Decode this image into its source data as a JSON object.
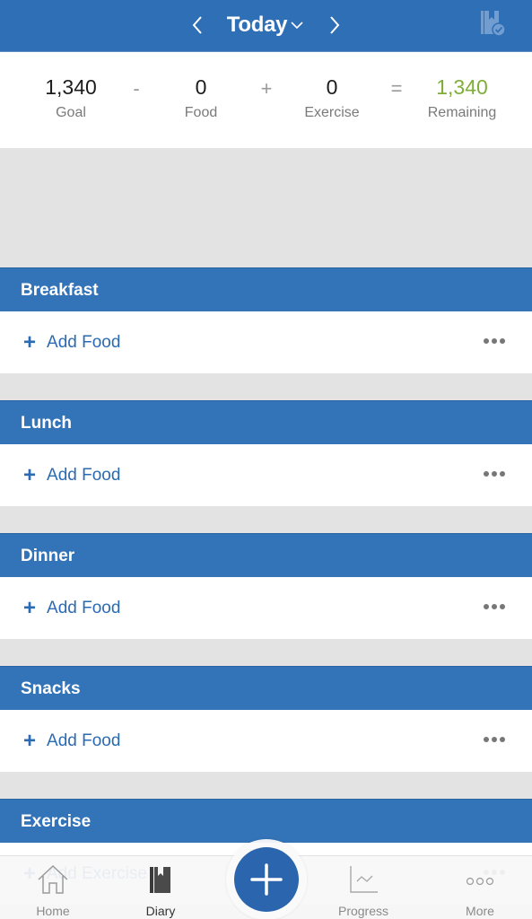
{
  "header": {
    "title": "Today",
    "prev_icon": "chevron-left-icon",
    "next_icon": "chevron-right-icon",
    "caret_icon": "chevron-down-icon",
    "action_icon": "diary-complete-icon"
  },
  "summary": {
    "goal": {
      "value": "1,340",
      "label": "Goal"
    },
    "op1": "-",
    "food": {
      "value": "0",
      "label": "Food"
    },
    "op2": "+",
    "exercise": {
      "value": "0",
      "label": "Exercise"
    },
    "op3": "=",
    "remaining": {
      "value": "1,340",
      "label": "Remaining"
    },
    "remaining_color": "#7fae38"
  },
  "sections": [
    {
      "title": "Breakfast",
      "action": "Add Food"
    },
    {
      "title": "Lunch",
      "action": "Add Food"
    },
    {
      "title": "Dinner",
      "action": "Add Food"
    },
    {
      "title": "Snacks",
      "action": "Add Food"
    },
    {
      "title": "Exercise",
      "action": "Add Exercise"
    }
  ],
  "plus_glyph": "+",
  "tabbar": {
    "items": [
      {
        "label": "Home",
        "icon": "home-icon",
        "active": false
      },
      {
        "label": "Diary",
        "icon": "diary-icon",
        "active": true
      },
      {
        "label": "",
        "icon": "plus-icon",
        "active": false
      },
      {
        "label": "Progress",
        "icon": "progress-chart-icon",
        "active": false
      },
      {
        "label": "More",
        "icon": "more-icon",
        "active": false
      }
    ]
  },
  "colors": {
    "brand_blue": "#2f6fb6",
    "section_blue": "#3373b7",
    "link_blue": "#2a6bb3",
    "remaining_green": "#7fae38",
    "background_gray": "#e3e3e3"
  }
}
